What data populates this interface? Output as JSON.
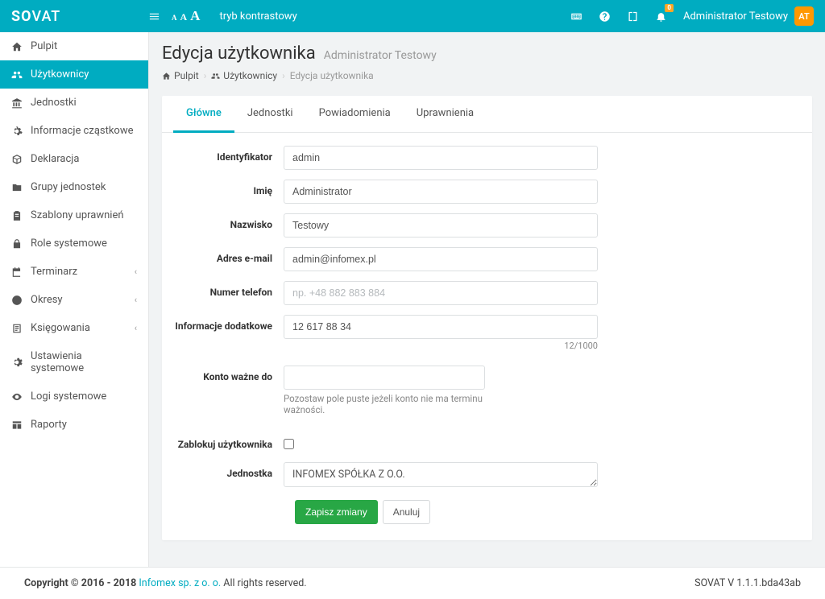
{
  "brand_bold": "SO",
  "brand_rest": "VAT",
  "navbar": {
    "contrast": "tryb kontrastowy",
    "notif_count": "0",
    "user_name": "Administrator Testowy",
    "user_initials": "AT"
  },
  "sidebar": {
    "items": [
      {
        "label": "Pulpit",
        "id": "pulpit"
      },
      {
        "label": "Użytkownicy",
        "id": "uzytkownicy",
        "active": true
      },
      {
        "label": "Jednostki",
        "id": "jednostki"
      },
      {
        "label": "Informacje cząstkowe",
        "id": "informacje"
      },
      {
        "label": "Deklaracja",
        "id": "deklaracja"
      },
      {
        "label": "Grupy jednostek",
        "id": "grupy"
      },
      {
        "label": "Szablony uprawnień",
        "id": "szablony"
      },
      {
        "label": "Role systemowe",
        "id": "role"
      },
      {
        "label": "Terminarz",
        "id": "terminarz",
        "chev": true
      },
      {
        "label": "Okresy",
        "id": "okresy",
        "chev": true
      },
      {
        "label": "Księgowania",
        "id": "ksiegowania",
        "chev": true
      },
      {
        "label": "Ustawienia systemowe",
        "id": "ustawienia"
      },
      {
        "label": "Logi systemowe",
        "id": "logi"
      },
      {
        "label": "Raporty",
        "id": "raporty"
      }
    ]
  },
  "page": {
    "title": "Edycja użytkownika",
    "subtitle": "Administrator Testowy"
  },
  "breadcrumb": {
    "home": "Pulpit",
    "users": "Użytkownicy",
    "current": "Edycja użytkownika"
  },
  "tabs": {
    "main": "Główne",
    "units": "Jednostki",
    "notif": "Powiadomienia",
    "perm": "Uprawnienia"
  },
  "form": {
    "labels": {
      "ident": "Identyfikator",
      "fname": "Imię",
      "lname": "Nazwisko",
      "email": "Adres e-mail",
      "phone": "Numer telefon",
      "extra": "Informacje dodatkowe",
      "valid": "Konto ważne do",
      "block": "Zablokuj użytkownika",
      "unit": "Jednostka"
    },
    "values": {
      "ident": "admin",
      "fname": "Administrator",
      "lname": "Testowy",
      "email": "admin@infomex.pl",
      "phone": "",
      "phone_placeholder": "np. +48 882 883 884",
      "extra": "12 617 88 34",
      "extra_counter": "12/1000",
      "valid": "",
      "valid_hint": "Pozostaw pole puste jeżeli konto nie ma terminu ważności.",
      "unit": "INFOMEX SPÓŁKA Z O.O."
    },
    "buttons": {
      "save": "Zapisz zmiany",
      "cancel": "Anuluj"
    }
  },
  "footer": {
    "copyright_prefix": "Copyright © 2016 - 2018 ",
    "company": "Infomex sp. z o. o.",
    "copyright_suffix": " All rights reserved.",
    "version": "SOVAT V 1.1.1.bda43ab"
  }
}
